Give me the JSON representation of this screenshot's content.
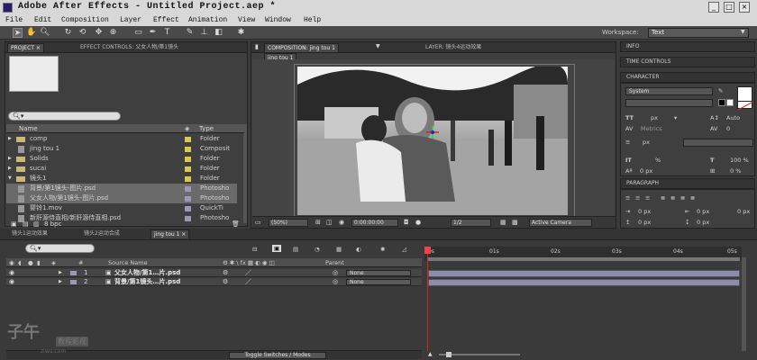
{
  "window": {
    "title": "Adobe After Effects - Untitled Project.aep *",
    "buttons": [
      "_",
      "□",
      "×"
    ]
  },
  "menubar": [
    "File",
    "Edit",
    "Composition",
    "Layer",
    "Effect",
    "Animation",
    "View",
    "Window",
    "Help"
  ],
  "toolbar": {
    "workspace_label": "Workspace:",
    "workspace_value": "Text"
  },
  "project_panel": {
    "tabs": [
      "PROJECT ×",
      "EFFECT CONTROLS: 父女人物/第1镜头"
    ],
    "bpc": "8 bpc",
    "columns": {
      "name": "Name",
      "type": "Type"
    },
    "items": [
      {
        "name": "comp",
        "type": "Folder",
        "kind": "folder",
        "color": "#d9c94a"
      },
      {
        "name": "jing tou 1",
        "type": "Composit",
        "kind": "comp",
        "color": "#d9c94a"
      },
      {
        "name": "Solids",
        "type": "Folder",
        "kind": "folder",
        "color": "#d9c94a"
      },
      {
        "name": "sucai",
        "type": "Folder",
        "kind": "folder",
        "color": "#d9c94a"
      },
      {
        "name": "镜头1",
        "type": "Folder",
        "kind": "folder-open",
        "color": "#d9c94a"
      },
      {
        "name": "背景/第1镜头-图片.psd",
        "type": "Photosho",
        "kind": "file",
        "color": "#9a9ab8",
        "selected": true
      },
      {
        "name": "父女人物/第1镜头-图片.psd",
        "type": "Photosho",
        "kind": "file",
        "color": "#9a9ab8",
        "selected": true
      },
      {
        "name": "婴铃1.mov",
        "type": "QuickTi",
        "kind": "file",
        "color": "#9a9ab8"
      },
      {
        "name": "新肝源侍直相/新肝源侍直相.psd",
        "type": "Photosho",
        "kind": "file",
        "color": "#9a9ab8"
      }
    ]
  },
  "composition_panel": {
    "tabs": [
      "COMPOSITION: jing tou 1",
      "LAYER: 镜头4运动效果"
    ],
    "comp_tab": "jing tou 1",
    "zoom": "(50%)",
    "timecode": "0:00:00:00",
    "resolution": "1/2",
    "camera": "Active Camera"
  },
  "right_panels": {
    "info": "INFO",
    "time_controls": "TIME CONTROLS",
    "character": {
      "title": "CHARACTER",
      "font": "System",
      "size_unit": "px",
      "leading": "Auto",
      "kerning": "Metrics",
      "tracking": "0",
      "stroke_unit": "px",
      "vscale": "%",
      "hscale": "100 %",
      "baseline": "0 px",
      "tsume": "0 %"
    },
    "paragraph": {
      "title": "PARAGRAPH",
      "indent_left": "0 px",
      "indent_right": "0 px",
      "indent_first": "0 px",
      "space_before": "0 px",
      "space_after": "0 px"
    }
  },
  "timeline": {
    "tabs": [
      "镜头1运动效果",
      "镜头2运动合成",
      "jing tou 1 ×"
    ],
    "columns": {
      "source_name": "Source Name",
      "parent": "Parent"
    },
    "ruler": [
      "0s",
      "01s",
      "02s",
      "03s",
      "04s",
      "05s"
    ],
    "layers": [
      {
        "num": "1",
        "name": "父女人物/第1…片.psd",
        "parent": "None"
      },
      {
        "num": "2",
        "name": "背景/第1镜头…片.psd",
        "parent": "None"
      }
    ],
    "toggle_label": "Toggle Switches / Modes"
  },
  "watermark": {
    "logo": "子午",
    "sub": "教程影视",
    "url": "ziwu.com"
  }
}
